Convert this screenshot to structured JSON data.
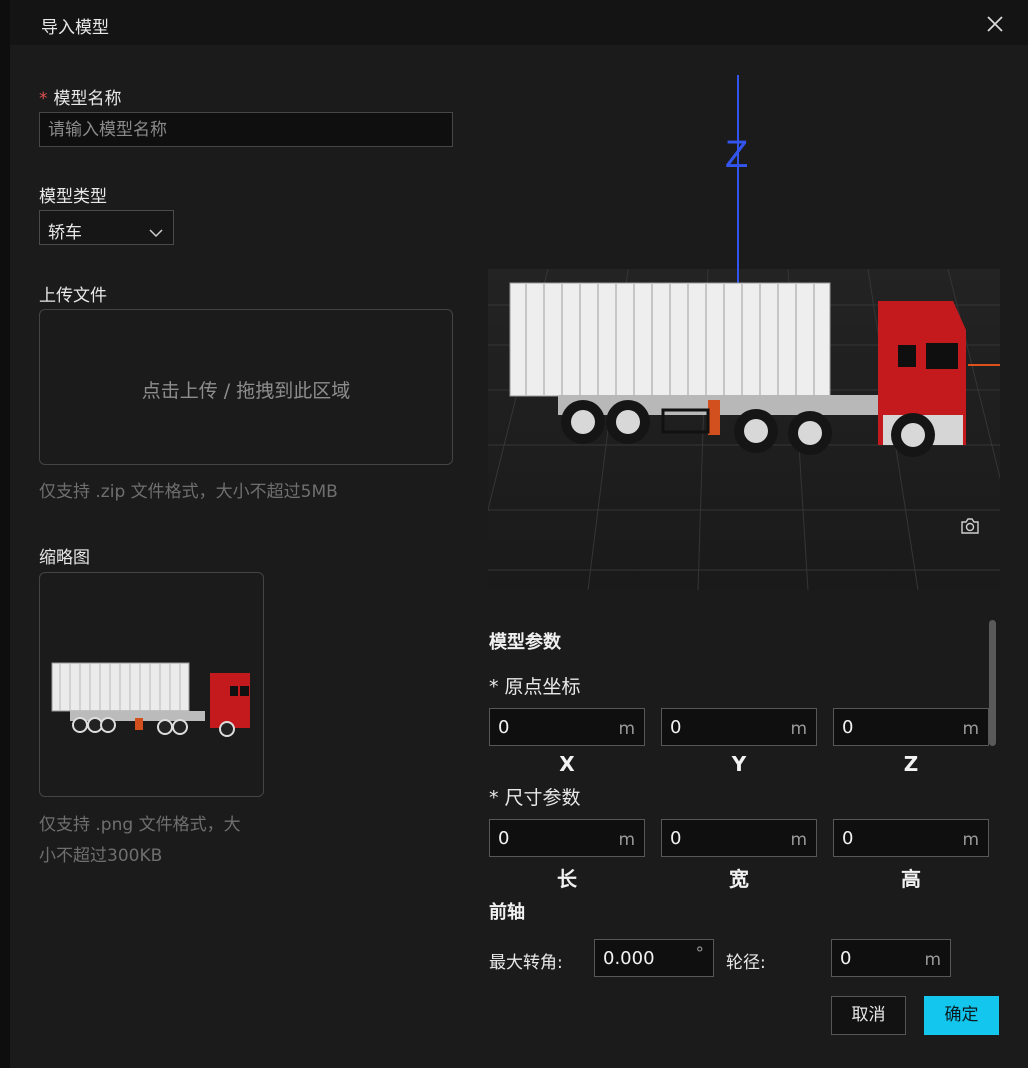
{
  "dialog": {
    "title": "导入模型",
    "close_icon": "close-icon"
  },
  "form": {
    "name": {
      "required_mark": "*",
      "label": "模型名称",
      "placeholder": "请输入模型名称",
      "value": ""
    },
    "type": {
      "label": "模型类型",
      "selected": "轿车",
      "icon": "chevron-down-icon"
    },
    "upload": {
      "label": "上传文件",
      "dropzone_text": "点击上传 / 拖拽到此区域",
      "hint": "仅支持 .zip 文件格式，大小不超过5MB"
    },
    "thumbnail": {
      "label": "缩略图",
      "hint_line1": "仅支持 .png 文件格式，大",
      "hint_line2": "小不超过300KB"
    }
  },
  "viewport": {
    "axis_z_label": "Z",
    "camera_icon": "camera-icon",
    "colors": {
      "truck_cab": "#c41a1e",
      "container": "#e8e8e8",
      "z_axis": "#3355ee",
      "x_axis": "#e0501a"
    }
  },
  "params": {
    "section_title": "模型参数",
    "origin": {
      "label": "* 原点坐标",
      "fields": [
        {
          "value": "0",
          "unit": "m",
          "axis": "X"
        },
        {
          "value": "0",
          "unit": "m",
          "axis": "Y"
        },
        {
          "value": "0",
          "unit": "m",
          "axis": "Z"
        }
      ]
    },
    "size": {
      "label": "* 尺寸参数",
      "fields": [
        {
          "value": "0",
          "unit": "m",
          "axis": "长"
        },
        {
          "value": "0",
          "unit": "m",
          "axis": "宽"
        },
        {
          "value": "0",
          "unit": "m",
          "axis": "高"
        }
      ]
    },
    "front_axle": {
      "title": "前轴",
      "max_angle_label": "最大转角:",
      "max_angle_value": "0.000",
      "max_angle_unit": "°",
      "wheel_diameter_label": "轮径:",
      "wheel_diameter_value": "0",
      "wheel_diameter_unit": "m"
    }
  },
  "footer": {
    "cancel": "取消",
    "ok": "确定"
  }
}
